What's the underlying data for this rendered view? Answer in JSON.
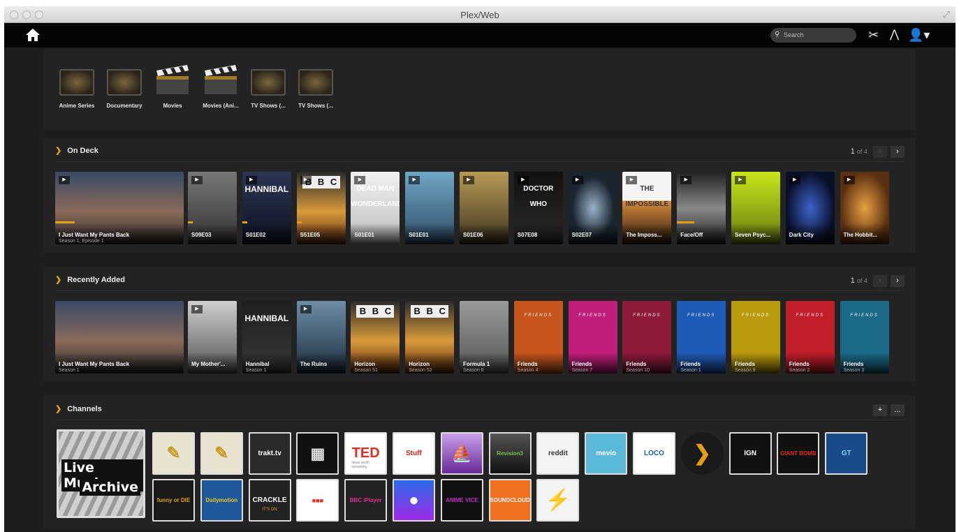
{
  "window": {
    "title": "Plex/Web"
  },
  "nav": {
    "search_placeholder": "Search",
    "icons": [
      "home-icon",
      "search-icon",
      "tools-icon",
      "activity-icon",
      "user-icon"
    ]
  },
  "libraries": [
    {
      "label": "Anime Series",
      "icon": "tv-icon"
    },
    {
      "label": "Documentary",
      "icon": "tv-icon"
    },
    {
      "label": "Movies",
      "icon": "clapperboard-icon"
    },
    {
      "label": "Movies (Ani...",
      "icon": "clapperboard-icon"
    },
    {
      "label": "TV Shows (...",
      "icon": "tv-icon"
    },
    {
      "label": "TV Shows (...",
      "icon": "tv-icon"
    }
  ],
  "on_deck": {
    "title": "On Deck",
    "pager": {
      "current": "1",
      "of": "of 4"
    },
    "items": [
      {
        "title": "I Just Want My Pants Back",
        "subtitle": "Season 1, Episode 1"
      },
      {
        "title": "S09E03",
        "subtitle": ""
      },
      {
        "title": "S01E02",
        "subtitle": "",
        "banner": "HANNIBAL"
      },
      {
        "title": "S51E05",
        "subtitle": ""
      },
      {
        "title": "S01E01",
        "subtitle": "",
        "banner": "DEAD MAN WONDERLAND"
      },
      {
        "title": "S01E01",
        "subtitle": ""
      },
      {
        "title": "S01E06",
        "subtitle": ""
      },
      {
        "title": "S07E08",
        "subtitle": "",
        "banner": "DOCTOR WHO"
      },
      {
        "title": "S02E07",
        "subtitle": ""
      },
      {
        "title": "The Imposs...",
        "subtitle": "",
        "banner": "THE IMPOSSIBLE"
      },
      {
        "title": "Face/Off",
        "subtitle": ""
      },
      {
        "title": "Seven Psyc...",
        "subtitle": ""
      },
      {
        "title": "Dark City",
        "subtitle": ""
      },
      {
        "title": "The Hobbit...",
        "subtitle": ""
      }
    ]
  },
  "recently_added": {
    "title": "Recently Added",
    "pager": {
      "current": "1",
      "of": "of 4"
    },
    "items": [
      {
        "title": "I Just Want My Pants Back",
        "subtitle": "Season 1"
      },
      {
        "title": "My Mother'...",
        "subtitle": ""
      },
      {
        "title": "Hannibal",
        "subtitle": "Season 1",
        "banner": "HANNIBAL"
      },
      {
        "title": "The Ruins",
        "subtitle": ""
      },
      {
        "title": "Horizon",
        "subtitle": "Season 51"
      },
      {
        "title": "Horizon",
        "subtitle": "Season 52"
      },
      {
        "title": "Formula 1",
        "subtitle": "Season 6"
      },
      {
        "title": "Friends",
        "subtitle": "Season 4",
        "banner": "FRIENDS"
      },
      {
        "title": "Friends",
        "subtitle": "Season 7",
        "banner": "FRIENDS"
      },
      {
        "title": "Friends",
        "subtitle": "Season 10",
        "banner": "FRIENDS"
      },
      {
        "title": "Friends",
        "subtitle": "Season 1",
        "banner": "FRIENDS"
      },
      {
        "title": "Friends",
        "subtitle": "Season 9",
        "banner": "FRIENDS"
      },
      {
        "title": "Friends",
        "subtitle": "Season 2",
        "banner": "FRIENDS"
      },
      {
        "title": "Friends",
        "subtitle": "Season 3",
        "banner": "FRIENDS"
      }
    ]
  },
  "channels": {
    "title": "Channels",
    "add_label": "+",
    "more_label": "...",
    "featured": {
      "line1": "Live Music",
      "line2": "Archive"
    },
    "row1": [
      "",
      "",
      "trakt.tv",
      "",
      "TED",
      "Stuff",
      "",
      "Revision3",
      "reddit",
      "mevio",
      "LOCO",
      "",
      "IGN",
      "GIANT BOMB",
      "GT"
    ],
    "row2": [
      "funny or DIE",
      "Dailymotion",
      "CRACKLE",
      "",
      "BBC iPlayer",
      "",
      "ANIME VICE",
      "SOUNDCLOUD",
      ""
    ],
    "ted_sub": "Ideas worth spreading",
    "crackle_sub": "IT'S ON"
  },
  "colors": {
    "accent": "#e5a00d",
    "background": "#1d1d1d",
    "panel": "#232323",
    "navbar": "#050505"
  }
}
